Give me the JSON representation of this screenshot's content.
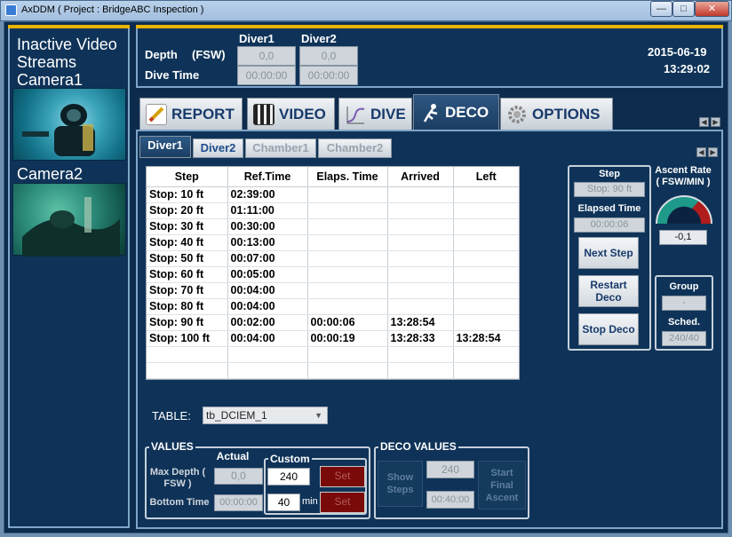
{
  "window": {
    "title": "AxDDM ( Project : BridgeABC Inspection )",
    "minimize": "—",
    "maximize": "□",
    "close": "✕"
  },
  "left_panel": {
    "inactive_label": "Inactive Video Streams",
    "camera1": "Camera1",
    "camera2": "Camera2"
  },
  "info": {
    "diver1_header": "Diver1",
    "diver2_header": "Diver2",
    "depth_label": "Depth",
    "depth_unit": "(FSW)",
    "dive_time_label": "Dive Time",
    "diver1_depth": "0,0",
    "diver2_depth": "0,0",
    "diver1_time": "00:00:00",
    "diver2_time": "00:00:00",
    "date": "2015-06-19",
    "time": "13:29:02"
  },
  "main_tabs": [
    {
      "label": "REPORT",
      "icon": "report-icon"
    },
    {
      "label": "VIDEO",
      "icon": "video-icon"
    },
    {
      "label": "DIVE",
      "icon": "dive-icon"
    },
    {
      "label": "DECO",
      "icon": "diver-icon"
    },
    {
      "label": "OPTIONS",
      "icon": "gear-icon"
    }
  ],
  "sub_tabs": [
    "Diver1",
    "Diver2",
    "Chamber1",
    "Chamber2"
  ],
  "table": {
    "headers": [
      "Step",
      "Ref.Time",
      "Elaps. Time",
      "Arrived",
      "Left"
    ],
    "rows": [
      [
        "Stop: 10 ft",
        "02:39:00",
        "",
        "",
        ""
      ],
      [
        "Stop: 20 ft",
        "01:11:00",
        "",
        "",
        ""
      ],
      [
        "Stop: 30 ft",
        "00:30:00",
        "",
        "",
        ""
      ],
      [
        "Stop: 40 ft",
        "00:13:00",
        "",
        "",
        ""
      ],
      [
        "Stop: 50 ft",
        "00:07:00",
        "",
        "",
        ""
      ],
      [
        "Stop: 60 ft",
        "00:05:00",
        "",
        "",
        ""
      ],
      [
        "Stop: 70 ft",
        "00:04:00",
        "",
        "",
        ""
      ],
      [
        "Stop: 80 ft",
        "00:04:00",
        "",
        "",
        ""
      ],
      [
        "Stop: 90 ft",
        "00:02:00",
        "00:00:06",
        "13:28:54",
        ""
      ],
      [
        "Stop: 100 ft",
        "00:04:00",
        "00:00:19",
        "13:28:33",
        "13:28:54"
      ],
      [
        "",
        "",
        "",
        "",
        ""
      ],
      [
        "",
        "",
        "",
        "",
        ""
      ]
    ]
  },
  "step_panel": {
    "step_label": "Step",
    "step_value": "Stop: 90 ft",
    "elapsed_label": "Elapsed Time",
    "elapsed_value": "00:00:06",
    "next_step": "Next Step",
    "restart_deco": "Restart Deco",
    "stop_deco": "Stop Deco"
  },
  "ascent": {
    "label": "Ascent Rate ( FSW/MIN )",
    "value": "-0,1",
    "gauge_level": 0.5,
    "colors": {
      "green": "#1f9a8a",
      "red": "#b01c1c",
      "dark": "#0b2340"
    }
  },
  "group_panel": {
    "group_label": "Group",
    "group_value": "-",
    "sched_label": "Sched.",
    "sched_value": "240/40"
  },
  "table_select": {
    "label": "TABLE:",
    "value": "tb_DCIEM_1"
  },
  "values": {
    "legend": "VALUES",
    "actual_label": "Actual",
    "custom_legend": "Custom",
    "max_depth_label": "Max Depth ( FSW )",
    "max_depth_actual": "0,0",
    "max_depth_custom": "240",
    "bottom_time_label": "Bottom Time",
    "bottom_time_actual": "00:00:00",
    "bottom_time_custom": "40",
    "min_unit": "min",
    "set_label": "Set"
  },
  "deco_values": {
    "legend": "DECO VALUES",
    "show_steps": "Show Steps",
    "value1": "240",
    "value2": "00:40:00",
    "start_final_ascent": "Start Final Ascent"
  }
}
